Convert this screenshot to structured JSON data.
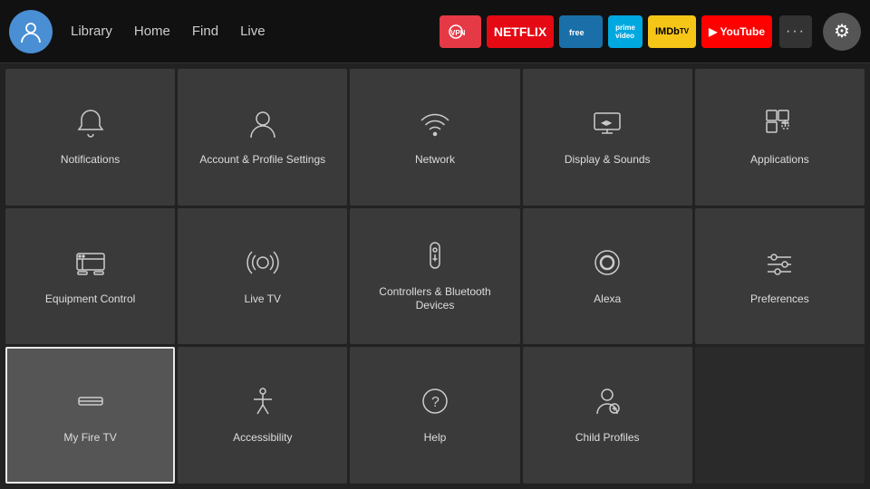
{
  "nav": {
    "links": [
      "Library",
      "Home",
      "Find",
      "Live"
    ],
    "apps": [
      {
        "label": "ExpressVPN",
        "class": "app-expressvpn"
      },
      {
        "label": "NETFLIX",
        "class": "app-netflix"
      },
      {
        "label": "▶",
        "class": "app-freevee"
      },
      {
        "label": "prime video",
        "class": "app-prime"
      },
      {
        "label": "IMDbTV",
        "class": "app-imdb"
      },
      {
        "label": "▶ YouTube",
        "class": "app-youtube"
      }
    ],
    "more_label": "···",
    "settings_icon": "⚙"
  },
  "grid": {
    "items": [
      {
        "id": "notifications",
        "label": "Notifications",
        "icon": "bell"
      },
      {
        "id": "account-profile",
        "label": "Account & Profile Settings",
        "icon": "person"
      },
      {
        "id": "network",
        "label": "Network",
        "icon": "wifi"
      },
      {
        "id": "display-sounds",
        "label": "Display & Sounds",
        "icon": "display"
      },
      {
        "id": "applications",
        "label": "Applications",
        "icon": "apps"
      },
      {
        "id": "equipment-control",
        "label": "Equipment Control",
        "icon": "tv"
      },
      {
        "id": "live-tv",
        "label": "Live TV",
        "icon": "antenna"
      },
      {
        "id": "controllers-bluetooth",
        "label": "Controllers & Bluetooth Devices",
        "icon": "remote"
      },
      {
        "id": "alexa",
        "label": "Alexa",
        "icon": "alexa"
      },
      {
        "id": "preferences",
        "label": "Preferences",
        "icon": "sliders"
      },
      {
        "id": "my-fire-tv",
        "label": "My Fire TV",
        "icon": "firetv",
        "selected": true
      },
      {
        "id": "accessibility",
        "label": "Accessibility",
        "icon": "accessibility"
      },
      {
        "id": "help",
        "label": "Help",
        "icon": "help"
      },
      {
        "id": "child-profiles",
        "label": "Child Profiles",
        "icon": "child"
      }
    ]
  }
}
